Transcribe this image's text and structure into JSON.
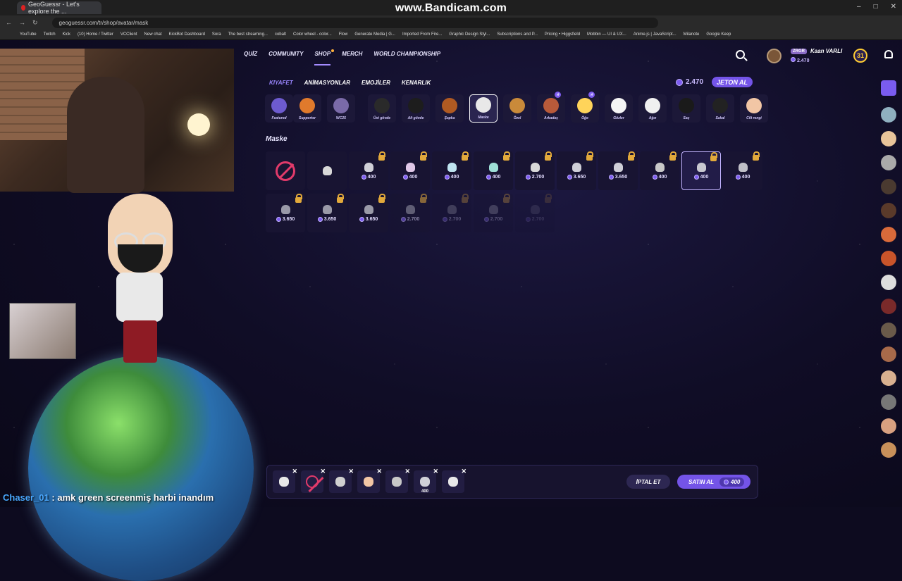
{
  "overlay": {
    "recorder": "www.Bandicam.com"
  },
  "browser": {
    "tab_title": "GeoGuessr - Let's explore the ...",
    "url": "geoguessr.com/tr/shop/avatar/mask",
    "bookmarks": [
      "YouTube",
      "Twitch",
      "Kick",
      "(10) Home / Twitter",
      "VCClient",
      "New chat",
      "KickBot Dashboard",
      "Sora",
      "The best streaming...",
      "cobalt",
      "Color wheel - color...",
      "Flow",
      "Generate Media | G...",
      "Imported From Fire...",
      "Graphic Design Styl...",
      "Subscriptions and P...",
      "Pricing • Higgsfield",
      "Mobbin — UI & UX...",
      "Anime.js | JavaScript...",
      "Milanote",
      "Google Keep"
    ]
  },
  "nav": {
    "items": [
      "QUİZ",
      "COMMUNITY",
      "SHOP",
      "MERCH",
      "WORLD CHAMPIONSHIP"
    ],
    "active": "SHOP"
  },
  "user": {
    "tag": "ZRGR",
    "name": "Kaan VARLI",
    "coins": "2.470",
    "level": "31"
  },
  "subtabs": {
    "items": [
      "KIYAFET",
      "ANİMASYONLAR",
      "EMOJİLER",
      "KENARLIK"
    ],
    "selected": "KIYAFET"
  },
  "wallet": {
    "coins": "2.470",
    "buy_label": "JETON AL"
  },
  "categories": [
    {
      "label": "Featured",
      "color": "#6d5bd0"
    },
    {
      "label": "Supporter",
      "color": "#e07a2c"
    },
    {
      "label": "WC25",
      "color": "#7a6aa8"
    },
    {
      "label": "Üst gövde",
      "color": "#2a2a2a"
    },
    {
      "label": "Alt gövde",
      "color": "#1d1d1d"
    },
    {
      "label": "Şapka",
      "color": "#b05a22"
    },
    {
      "label": "Maske",
      "color": "#e8e8e8"
    },
    {
      "label": "Özel",
      "color": "#c98a3a"
    },
    {
      "label": "Arkadaş",
      "color": "#b85a3a"
    },
    {
      "label": "Öğe",
      "color": "#ffd45a"
    },
    {
      "label": "Gözler",
      "color": "#f5f5f5"
    },
    {
      "label": "Ağız",
      "color": "#f0f0f0"
    },
    {
      "label": "Saç",
      "color": "#1a1a1a"
    },
    {
      "label": "Sakal",
      "color": "#222222"
    },
    {
      "label": "Cilt rengi",
      "color": "#f2c6a5"
    }
  ],
  "section_title": "Maske",
  "items_row1": [
    {
      "kind": "none",
      "price": "",
      "locked": false
    },
    {
      "kind": "mask",
      "price": "",
      "locked": false,
      "color": "#d8d8d8"
    },
    {
      "kind": "mask",
      "price": "400",
      "locked": true,
      "color": "#d0d0d8"
    },
    {
      "kind": "mask",
      "price": "400",
      "locked": true,
      "color": "#e0c8e8"
    },
    {
      "kind": "mask",
      "price": "400",
      "locked": true,
      "color": "#bfe4f0"
    },
    {
      "kind": "mask",
      "price": "400",
      "locked": true,
      "color": "#9fe0d8"
    },
    {
      "kind": "mask",
      "price": "2.700",
      "locked": true,
      "color": "#d8d8d8"
    },
    {
      "kind": "mask",
      "price": "3.650",
      "locked": true,
      "color": "#cfcfd8"
    },
    {
      "kind": "mask",
      "price": "3.650",
      "locked": true,
      "color": "#cfcfd8"
    },
    {
      "kind": "mask",
      "price": "400",
      "locked": true,
      "color": "#c8c8c8"
    },
    {
      "kind": "mask",
      "price": "400",
      "locked": true,
      "color": "#c8c8d0",
      "selected": true
    },
    {
      "kind": "mask",
      "price": "400",
      "locked": true,
      "color": "#c0c0c8"
    }
  ],
  "items_row2": [
    {
      "price": "3.650",
      "fade": ""
    },
    {
      "price": "3.650",
      "fade": ""
    },
    {
      "price": "3.650",
      "fade": ""
    },
    {
      "price": "2.700",
      "fade": "faded"
    },
    {
      "price": "2.700",
      "fade": "faded2"
    },
    {
      "price": "2.700",
      "fade": "faded2"
    },
    {
      "price": "2.700",
      "fade": "faded3"
    }
  ],
  "cart": {
    "slots": [
      {
        "label": "",
        "color": "#e8e8e8"
      },
      {
        "label": "",
        "color": "none"
      },
      {
        "label": "",
        "color": "#d0d0d0"
      },
      {
        "label": "",
        "color": "#f2c6a5"
      },
      {
        "label": "",
        "color": "#c8c8c8"
      },
      {
        "label": "400",
        "color": "#d0d0d8"
      },
      {
        "label": "",
        "color": "#e8e8e8"
      }
    ],
    "cancel_label": "İPTAL ET",
    "buy_label": "SATIN AL",
    "total": "400"
  },
  "chat": {
    "user": "Chaser_01",
    "message": ": amk green screenmiş harbi inandım"
  },
  "colors": {
    "accent": "#7454e8",
    "lock": "#e2a93b",
    "none_icon": "#e13a6a"
  }
}
